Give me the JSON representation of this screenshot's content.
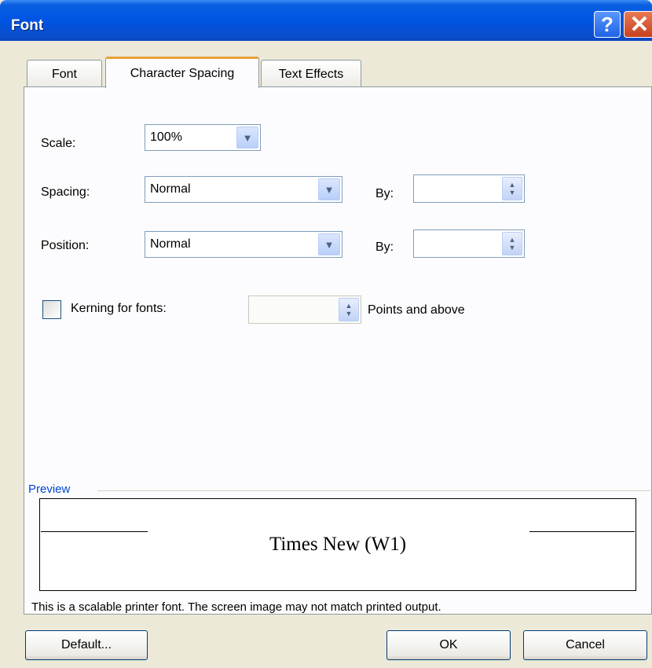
{
  "window": {
    "title": "Font"
  },
  "titlebar_buttons": {
    "help": "?",
    "close": "✕"
  },
  "tabs": [
    {
      "label": "Font",
      "active": false
    },
    {
      "label": "Character Spacing",
      "active": true
    },
    {
      "label": "Text Effects",
      "active": false
    }
  ],
  "scale": {
    "label": "Scale:",
    "value": "100%"
  },
  "spacing": {
    "label": "Spacing:",
    "value": "Normal",
    "by_label": "By:",
    "by_value": ""
  },
  "position": {
    "label": "Position:",
    "value": "Normal",
    "by_label": "By:",
    "by_value": ""
  },
  "kerning": {
    "label": "Kerning for fonts:",
    "checked": false,
    "value": "",
    "suffix": "Points and above"
  },
  "preview": {
    "legend": "Preview",
    "sample": "Times New (W1)",
    "note": "This is a scalable printer font. The screen image may not match printed output."
  },
  "buttons": {
    "default": "Default...",
    "ok": "OK",
    "cancel": "Cancel"
  },
  "colors": {
    "title_bar": "#0054e3",
    "dialog_bg": "#ece9d8",
    "active_tab_accent": "#e8a23a",
    "preview_legend": "#0046d5"
  },
  "icons": {
    "dropdown": "chevron-down-icon",
    "spin": "spin-arrows-icon",
    "help": "help-icon",
    "close": "close-icon"
  }
}
